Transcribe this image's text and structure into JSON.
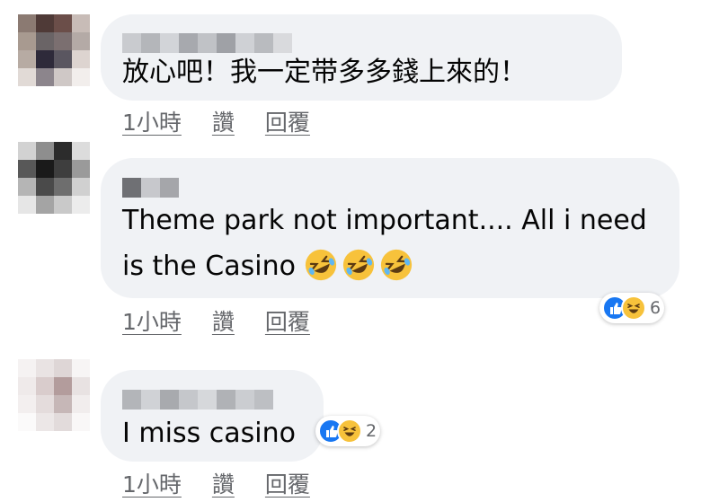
{
  "comments": [
    {
      "text": "放心吧！我一定带多多錢上來的！",
      "time": "1小時",
      "like_label": "讚",
      "reply_label": "回覆"
    },
    {
      "text_line1": "Theme park not important.... All i need",
      "text_line2": "is the Casino",
      "emojis": [
        "rolling-on-floor-laughing",
        "rolling-on-floor-laughing",
        "rolling-on-floor-laughing"
      ],
      "reactions": {
        "types": [
          "like",
          "haha"
        ],
        "count": "6"
      },
      "time": "1小時",
      "like_label": "讚",
      "reply_label": "回覆"
    },
    {
      "text": "I miss casino",
      "reactions": {
        "types": [
          "like",
          "haha"
        ],
        "count": "2"
      },
      "time": "1小時",
      "like_label": "讚",
      "reply_label": "回覆"
    }
  ],
  "colors": {
    "bubble": "#f0f2f5",
    "text": "#050505",
    "secondary": "#65676b",
    "like": "#1877f2",
    "haha": "#f7c23b"
  }
}
